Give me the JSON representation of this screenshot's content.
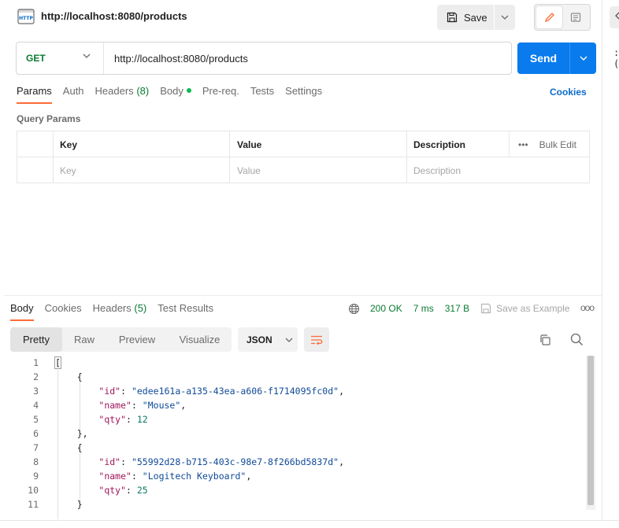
{
  "header": {
    "title": "http://localhost:8080/products",
    "save_label": "Save",
    "icon": "http-icon"
  },
  "request": {
    "method": "GET",
    "url": "http://localhost:8080/products",
    "send_label": "Send"
  },
  "req_tabs": {
    "params": "Params",
    "auth": "Auth",
    "headers": "Headers",
    "headers_count": "(8)",
    "body": "Body",
    "prereq": "Pre-req.",
    "tests": "Tests",
    "settings": "Settings",
    "cookies": "Cookies"
  },
  "query_params": {
    "title": "Query Params",
    "columns": [
      "Key",
      "Value",
      "Description"
    ],
    "bulk_edit": "Bulk Edit",
    "placeholders": [
      "Key",
      "Value",
      "Description"
    ]
  },
  "response": {
    "tabs": {
      "body": "Body",
      "cookies": "Cookies",
      "headers": "Headers",
      "headers_count": "(5)",
      "test_results": "Test Results"
    },
    "status": "200 OK",
    "time": "7 ms",
    "size": "317 B",
    "save_example": "Save as Example",
    "views": [
      "Pretty",
      "Raw",
      "Preview",
      "Visualize"
    ],
    "format": "JSON",
    "lines": [
      {
        "n": "1",
        "t": "["
      },
      {
        "n": "2",
        "t": "    {"
      },
      {
        "n": "3",
        "key": "\"id\"",
        "val": "\"edee161a-a135-43ea-a606-f1714095fc0d\"",
        "tail": ",",
        "type": "s"
      },
      {
        "n": "4",
        "key": "\"name\"",
        "val": "\"Mouse\"",
        "tail": ",",
        "type": "s"
      },
      {
        "n": "5",
        "key": "\"qty\"",
        "val": "12",
        "tail": "",
        "type": "n"
      },
      {
        "n": "6",
        "t": "    },"
      },
      {
        "n": "7",
        "t": "    {"
      },
      {
        "n": "8",
        "key": "\"id\"",
        "val": "\"55992d28-b715-403c-98e7-8f266bd5837d\"",
        "tail": ",",
        "type": "s"
      },
      {
        "n": "9",
        "key": "\"name\"",
        "val": "\"Logitech Keyboard\"",
        "tail": ",",
        "type": "s"
      },
      {
        "n": "10",
        "key": "\"qty\"",
        "val": "25",
        "tail": "",
        "type": "n"
      },
      {
        "n": "11",
        "t": "    }"
      }
    ]
  },
  "colors": {
    "accent": "#ff6c37",
    "send": "#097bed",
    "get_method": "#0a7a32",
    "status_ok": "#0a7a32"
  }
}
